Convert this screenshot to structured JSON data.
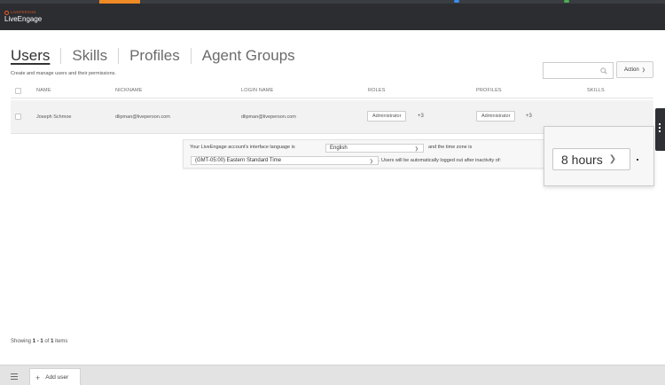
{
  "header": {
    "logo_small": "LIVEPERSON",
    "logo_text": "LiveEngage"
  },
  "tabs": [
    {
      "label": "Users"
    },
    {
      "label": "Skills"
    },
    {
      "label": "Profiles"
    },
    {
      "label": "Agent Groups"
    }
  ],
  "subtitle": "Create and manage users and their permissions.",
  "search": {
    "placeholder": "",
    "icon": "search-icon"
  },
  "action": {
    "label": "Action",
    "icon": "chevron-down-icon"
  },
  "table": {
    "columns": [
      "NAME",
      "NICKNAME",
      "LOGIN NAME",
      "ROLES",
      "PROFILES",
      "SKILLS"
    ],
    "rows": [
      {
        "name": "Joseph Schmoe",
        "nickname": "dlipman@liveperson.com",
        "login": "dlipman@liveperson.com",
        "role": "Administrator",
        "role_more": "+3",
        "profile": "Administrator",
        "profile_more": "+3"
      }
    ]
  },
  "language_panel": {
    "text_1": "Your LiveEngage account's interface language is",
    "language": "English",
    "text_2": "and the time zone is",
    "timezone": "(GMT-05:00) Eastern Standard Time",
    "text_3": ". Users will be automatically logged out after inactivity of:"
  },
  "hours": {
    "value": "8 hours"
  },
  "footer": {
    "showing_prefix": "Showing",
    "range": "1 - 1",
    "of": "of",
    "total": "1",
    "suffix": "items"
  },
  "bottom_bar": {
    "add_user_label": "Add user"
  },
  "colors": {
    "header_bg": "#2b2d31",
    "accent_orange": "#f15a24",
    "row_bg": "#f2f2f2",
    "bottom_bar_bg": "#e3e3e3"
  }
}
